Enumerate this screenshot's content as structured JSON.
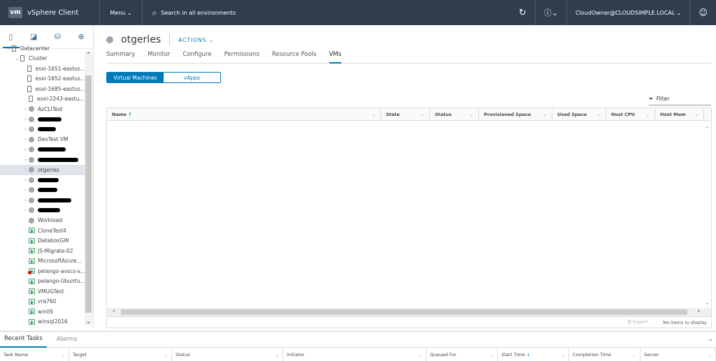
{
  "header": {
    "logo": "vm",
    "app_name": "vSphere Client",
    "menu": "Menu",
    "search_placeholder": "Search in all environments",
    "user": "CloudOwner@CLOUDSIMPLE.LOCAL",
    "icons": [
      "refresh-icon",
      "help-icon",
      "user-smiley-icon"
    ]
  },
  "sidebar": {
    "tabs": [
      "hosts-clusters-icon",
      "vms-templates-icon",
      "storage-icon",
      "networking-icon"
    ],
    "tree": [
      {
        "label": "Datacenter",
        "type": "datacenter",
        "level": 0,
        "expanded": true
      },
      {
        "label": "Cluster",
        "type": "cluster",
        "level": 1,
        "expanded": true
      },
      {
        "label": "esxi-1651-eastus...",
        "type": "host",
        "level": 2
      },
      {
        "label": "esxi-1652-eastus...",
        "type": "host",
        "level": 2
      },
      {
        "label": "esxi-1685-eastus...",
        "type": "host",
        "level": 2
      },
      {
        "label": "esxi-2243-eastu...",
        "type": "host",
        "level": 2
      },
      {
        "label": "AzCLITest",
        "type": "pool",
        "level": 2,
        "chev": true
      },
      {
        "label": "",
        "type": "pool",
        "level": 2,
        "chev": true,
        "redacted": true
      },
      {
        "label": "",
        "type": "pool",
        "level": 2,
        "chev": true,
        "redacted": true
      },
      {
        "label": "DevTest VM",
        "type": "pool",
        "level": 2,
        "chev": true
      },
      {
        "label": "",
        "type": "pool",
        "level": 2,
        "chev": true,
        "redacted": true
      },
      {
        "label": "",
        "type": "pool",
        "level": 2,
        "chev": true,
        "redacted": true
      },
      {
        "label": "otgerles",
        "type": "pool",
        "level": 2,
        "chev": true,
        "selected": true
      },
      {
        "label": "",
        "type": "pool",
        "level": 2,
        "chev": true,
        "redacted": true
      },
      {
        "label": "",
        "type": "pool",
        "level": 2,
        "chev": true,
        "redacted": true
      },
      {
        "label": "",
        "type": "pool",
        "level": 2,
        "chev": true,
        "redacted": true
      },
      {
        "label": "",
        "type": "pool",
        "level": 2,
        "chev": true,
        "redacted": true
      },
      {
        "label": "Workload",
        "type": "pool",
        "level": 2
      },
      {
        "label": "CloneTest4",
        "type": "vm",
        "level": 2
      },
      {
        "label": "DataboxGW",
        "type": "vm",
        "level": 2
      },
      {
        "label": "JS-Migrate-02",
        "type": "vm",
        "level": 2
      },
      {
        "label": "MicrosoftAzure...",
        "type": "vm",
        "level": 2
      },
      {
        "label": "pelango-avscs-v...",
        "type": "vm-error",
        "level": 2
      },
      {
        "label": "pelango-Ubuntu...",
        "type": "vm",
        "level": 2
      },
      {
        "label": "VMUGTest",
        "type": "vm",
        "level": 2
      },
      {
        "label": "vra760",
        "type": "vm",
        "level": 2
      },
      {
        "label": "winIIS",
        "type": "vm",
        "level": 2
      },
      {
        "label": "winsql2016",
        "type": "vm",
        "level": 2
      }
    ]
  },
  "main": {
    "title": "otgerles",
    "actions": "ACTIONS",
    "tabs": [
      "Summary",
      "Monitor",
      "Configure",
      "Permissions",
      "Resource Pools",
      "VMs"
    ],
    "active_tab": "VMs",
    "segments": [
      "Virtual Machines",
      "vApps"
    ],
    "filter": "Filter",
    "columns": [
      "Name",
      "State",
      "Status",
      "Provisioned Space",
      "Used Space",
      "Host CPU",
      "Host Mem"
    ],
    "export": "Export",
    "empty": "No items to display"
  },
  "bottom": {
    "tabs": [
      "Recent Tasks",
      "Alarms"
    ],
    "columns": [
      "Task Name",
      "Target",
      "Status",
      "Initiator",
      "Queued For",
      "Start Time",
      "Completion Time",
      "Server"
    ]
  },
  "colors": {
    "header": "#2f3d4f",
    "accent": "#0079b8"
  }
}
